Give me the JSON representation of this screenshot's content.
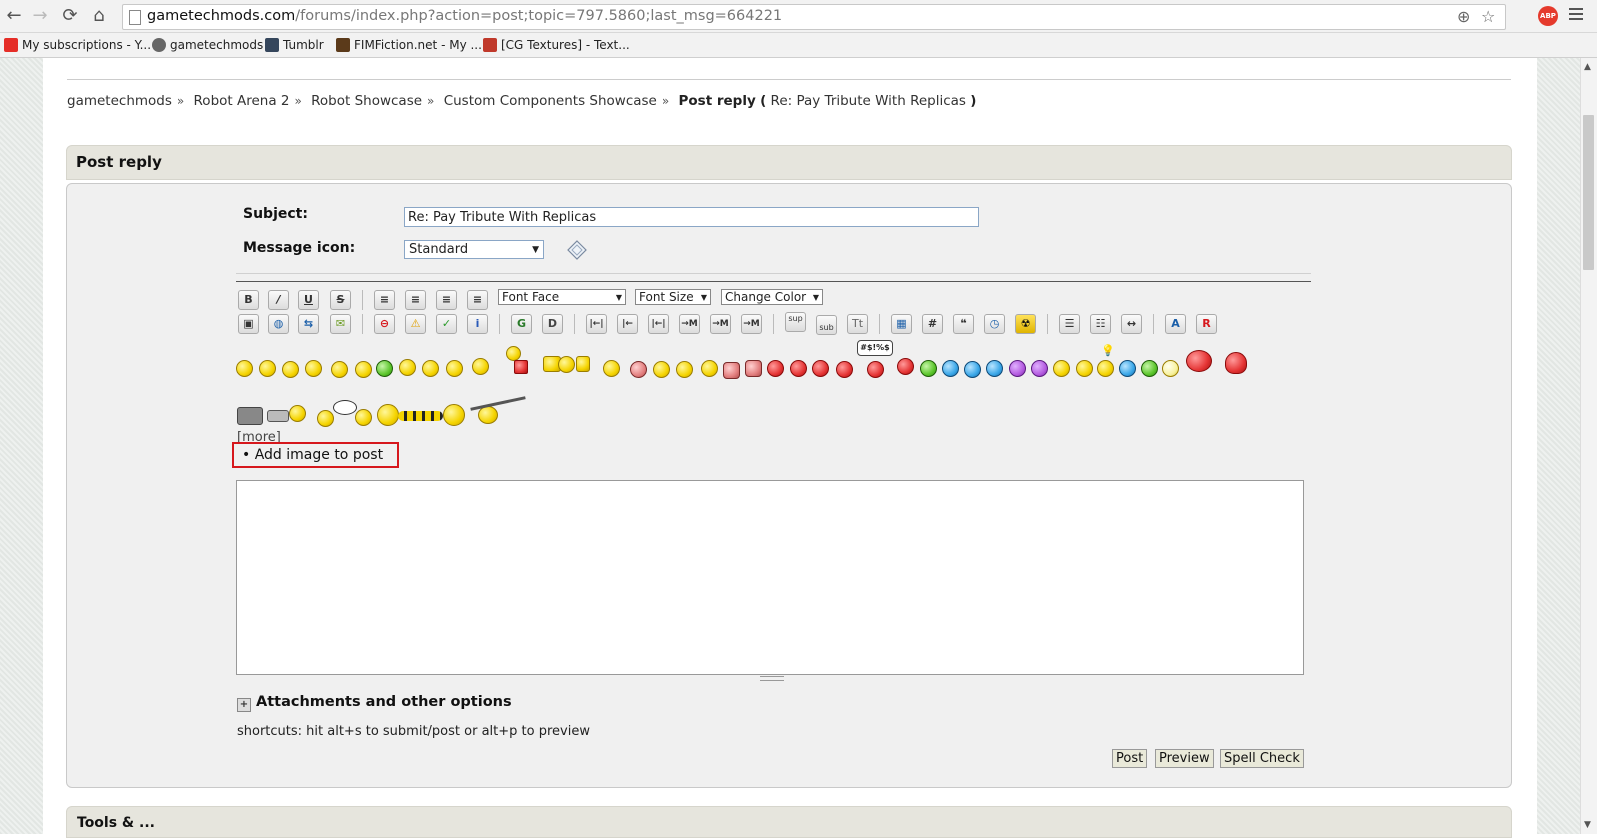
{
  "browser": {
    "url_domain": "gametechmods.com",
    "url_path": "/forums/index.php?action=post;topic=797.5860;last_msg=664221",
    "abp_label": "ABP",
    "bookmarks": [
      {
        "label": "My subscriptions - Y...",
        "icon": "youtube-icon",
        "color": "#e52d27"
      },
      {
        "label": "gametechmods",
        "icon": "gear-icon",
        "color": "#555555"
      },
      {
        "label": "Tumblr",
        "icon": "tumblr-icon",
        "color": "#35465c"
      },
      {
        "label": "FIMFiction.net - My ...",
        "icon": "fimfiction-icon",
        "color": "#5b3a1a"
      },
      {
        "label": "[CG Textures] - Text...",
        "icon": "cgtextures-icon",
        "color": "#c0392b"
      }
    ]
  },
  "breadcrumb": {
    "items": [
      "gametechmods",
      "Robot Arena 2",
      "Robot Showcase",
      "Custom Components Showcase"
    ],
    "separator": "»",
    "current_label": "Post reply",
    "open_paren": "(",
    "current_topic": "Re: Pay Tribute With Replicas",
    "close_paren": ")"
  },
  "form": {
    "title": "Post reply",
    "subject_label": "Subject:",
    "subject_value": "Re: Pay Tribute With Replicas",
    "message_icon_label": "Message icon:",
    "message_icon_value": "Standard",
    "font_face": "Font Face",
    "font_size": "Font Size",
    "change_color": "Change Color",
    "more_label": "[more]",
    "add_image_label": "• Add image to post",
    "attachments_label": "Attachments and other options",
    "shortcuts_text": "shortcuts: hit alt+s to submit/post or alt+p to preview",
    "post_button": "Post",
    "preview_button": "Preview",
    "spellcheck_button": "Spell Check",
    "bottom_bar_title": "Tools & ..."
  },
  "toolbar": {
    "row1": [
      "B",
      "/",
      "U",
      "S",
      "≡",
      "≡",
      "≡",
      "≡"
    ],
    "row2": [
      "▣",
      "◍",
      "⇆",
      "✉",
      "⊖",
      "⚠",
      "✓",
      "i",
      "G",
      "D",
      "|←|",
      "|←",
      "|←|",
      "→M",
      "→M",
      "→M",
      "sup",
      "sub",
      "Tt",
      "▦",
      "#",
      "❝",
      "◷",
      "☢",
      "☰",
      "☷",
      "↔",
      "A",
      "R"
    ],
    "sup": "sup",
    "sub": "sub",
    "tt": "Tt",
    "swear_label": "#$!%$"
  }
}
